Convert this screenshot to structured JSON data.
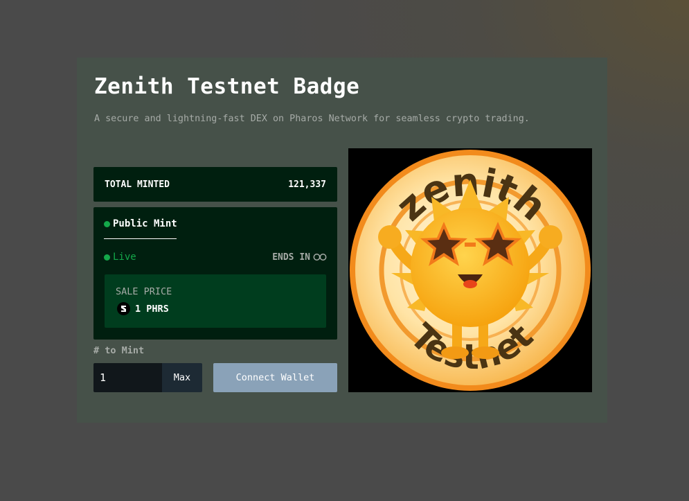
{
  "card": {
    "title": "Zenith Testnet Badge",
    "subtitle": "A secure and lightning-fast DEX on Pharos Network for seamless crypto trading."
  },
  "stats": {
    "total_minted_label": "TOTAL MINTED",
    "total_minted_value": "121,337"
  },
  "mint_panel": {
    "tab_label": "Public Mint",
    "status_label": "Live",
    "ends_in_label": "ENDS IN",
    "ends_in_icon": "infinity-icon",
    "sale_price_label": "SALE PRICE",
    "sale_price_value": "1 PHRS",
    "currency_icon": "phrs-token-icon",
    "status_color": "#14a84a"
  },
  "mint_form": {
    "quantity_label": "# to Mint",
    "quantity_value": "1",
    "max_label": "Max",
    "connect_label": "Connect Wallet"
  },
  "badge": {
    "top_text": "zenith",
    "bottom_text": "Testnet"
  }
}
